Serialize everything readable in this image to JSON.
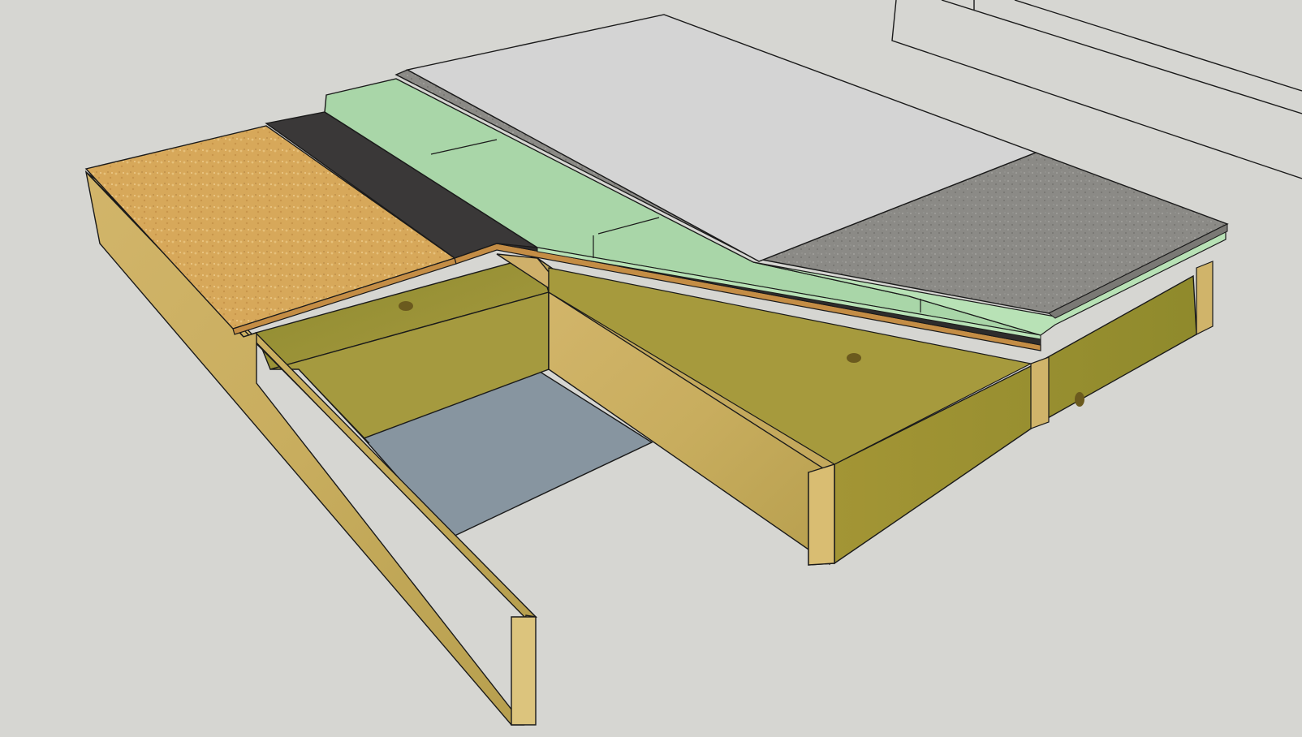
{
  "scene": {
    "background_color": "#d6d6d2",
    "edge_color": "#1a1a1a",
    "layers": [
      {
        "id": "osb-subfloor",
        "color": "#d7a85a"
      },
      {
        "id": "underlayment-membrane",
        "color": "#3a3838"
      },
      {
        "id": "foam-insulation-board",
        "color": "#a9d6a8"
      },
      {
        "id": "concrete-topping",
        "color": "#8b8a86"
      },
      {
        "id": "finish-slab-top",
        "color": "#d4d4d4"
      },
      {
        "id": "floor-joists",
        "color": "#b9a451"
      },
      {
        "id": "ground-plane",
        "color": "#8795a0"
      }
    ]
  }
}
